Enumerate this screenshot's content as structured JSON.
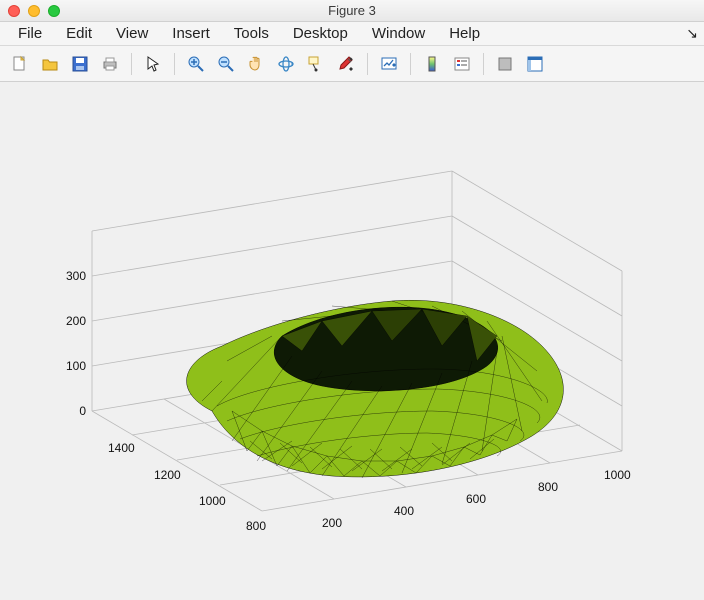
{
  "window": {
    "title": "Figure 3"
  },
  "menu": {
    "items": [
      "File",
      "Edit",
      "View",
      "Insert",
      "Tools",
      "Desktop",
      "Window",
      "Help"
    ]
  },
  "toolbar": {
    "icons": [
      "new-figure-icon",
      "open-file-icon",
      "save-icon",
      "print-icon",
      "pointer-icon",
      "zoom-in-icon",
      "zoom-out-icon",
      "pan-icon",
      "rotate-3d-icon",
      "data-cursor-icon",
      "brush-icon",
      "link-plot-icon",
      "insert-colorbar-icon",
      "insert-legend-icon",
      "hide-plot-tools-icon",
      "show-plot-tools-icon"
    ]
  },
  "chart_data": {
    "type": "surface_mesh_3d",
    "title": "",
    "z_axis": {
      "ticks": [
        0,
        100,
        200,
        300
      ],
      "range": [
        0,
        350
      ]
    },
    "x_axis": {
      "ticks": [
        800,
        1000,
        1200,
        1400
      ],
      "range": [
        800,
        1500
      ]
    },
    "y_axis": {
      "ticks": [
        200,
        400,
        600,
        800,
        1000
      ],
      "range": [
        100,
        1050
      ]
    },
    "surface_color": "#8fbf1a",
    "edge_color": "#000000"
  }
}
